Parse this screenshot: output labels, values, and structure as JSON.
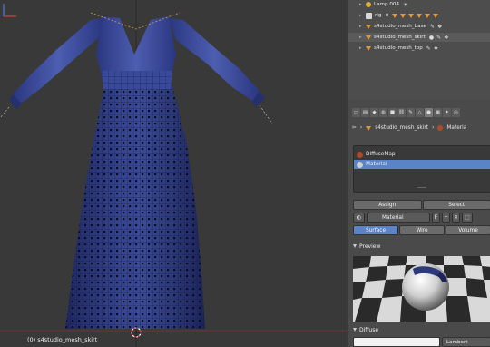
{
  "viewport": {
    "object_label": "(0) s4studio_mesh_skirt"
  },
  "outliner": {
    "items": [
      {
        "name": "Lamp.004",
        "icon": "lamp-icon",
        "color": "#e0b030"
      },
      {
        "name": "rig",
        "icon": "armature-icon",
        "color": "#d8d8d8"
      },
      {
        "name": "s4studio_mesh_base",
        "icon": "mesh-icon",
        "color": "#e39a3a"
      },
      {
        "name": "s4studio_mesh_skirt",
        "icon": "mesh-icon",
        "color": "#e39a3a"
      },
      {
        "name": "s4studio_mesh_top",
        "icon": "mesh-icon",
        "color": "#e39a3a"
      }
    ]
  },
  "properties": {
    "breadcrumb_object": "s4studio_mesh_skirt",
    "breadcrumb_material": "Materia",
    "slots": [
      {
        "name": "DiffuseMap",
        "selected": false,
        "color": "#b04a2a"
      },
      {
        "name": "Material",
        "selected": true,
        "color": "#cfcfcf"
      }
    ],
    "assign_label": "Assign",
    "select_label": "Select",
    "material_name": "Material",
    "fake_user_label": "F",
    "modes": [
      "Surface",
      "Wire",
      "Volume"
    ],
    "active_mode": "Surface",
    "preview_heading": "Preview",
    "diffuse_heading": "Diffuse",
    "diffuse_shader": "Lambert"
  },
  "colors": {
    "accent": "#5b83c8",
    "dress": "#2d3a7a"
  }
}
